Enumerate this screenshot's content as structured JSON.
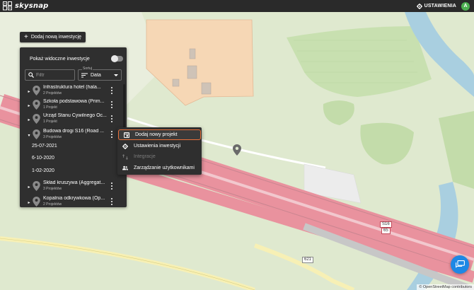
{
  "app": {
    "brand": "skysnap",
    "settings_label": "USTAWIENIA",
    "avatar_initial": "A"
  },
  "toolbar": {
    "add_investment_label": "Dodaj nową inwestycję"
  },
  "panel": {
    "show_visible_label": "Pokaż widoczne inwestycje",
    "search": {
      "placeholder": "Filtr",
      "value": ""
    },
    "sort": {
      "legend": "Sortuj",
      "value": "Data"
    },
    "items": [
      {
        "title": "Infrastruktura hotel (hala...",
        "sub": "2 Projektów",
        "expanded": false
      },
      {
        "title": "Szkoła podstawowa (Prim...",
        "sub": "1 Projekt",
        "expanded": false
      },
      {
        "title": "Urząd Stanu Cywilnego Oc...",
        "sub": "1 Projekt",
        "expanded": false
      },
      {
        "title": "Budowa drogi S16 (Road ...",
        "sub": "3 Projektów",
        "expanded": true
      },
      {
        "title": "Skład kruszywa (Aggregat...",
        "sub": "3 Projektów",
        "expanded": false
      },
      {
        "title": "Kopalnia odkrywkowa (Op...",
        "sub": "2 Projektów",
        "expanded": false
      }
    ],
    "dates": [
      "25-07-2021",
      "6-10-2020",
      "1-02-2020"
    ]
  },
  "context_menu": {
    "items": [
      {
        "label": "Dodaj nowy projekt",
        "icon": "add-project-icon",
        "enabled": true,
        "highlighted": true
      },
      {
        "label": "Ustawienia inwestycji",
        "icon": "gear-icon",
        "enabled": true,
        "highlighted": false
      },
      {
        "label": "Integracje",
        "icon": "integrations-icon",
        "enabled": false,
        "highlighted": false
      },
      {
        "label": "Zarządzanie użytkownikami",
        "icon": "users-icon",
        "enabled": true,
        "highlighted": false
      }
    ]
  },
  "map": {
    "road_labels": [
      "S16",
      "65",
      "621"
    ],
    "attribution": "© OpenStreetMap contributors"
  },
  "colors": {
    "accent": "#e8703a",
    "topbar": "#2a2a2a",
    "panel": "#2f2f2f",
    "fab": "#1e88e5",
    "avatar": "#4caf50"
  }
}
